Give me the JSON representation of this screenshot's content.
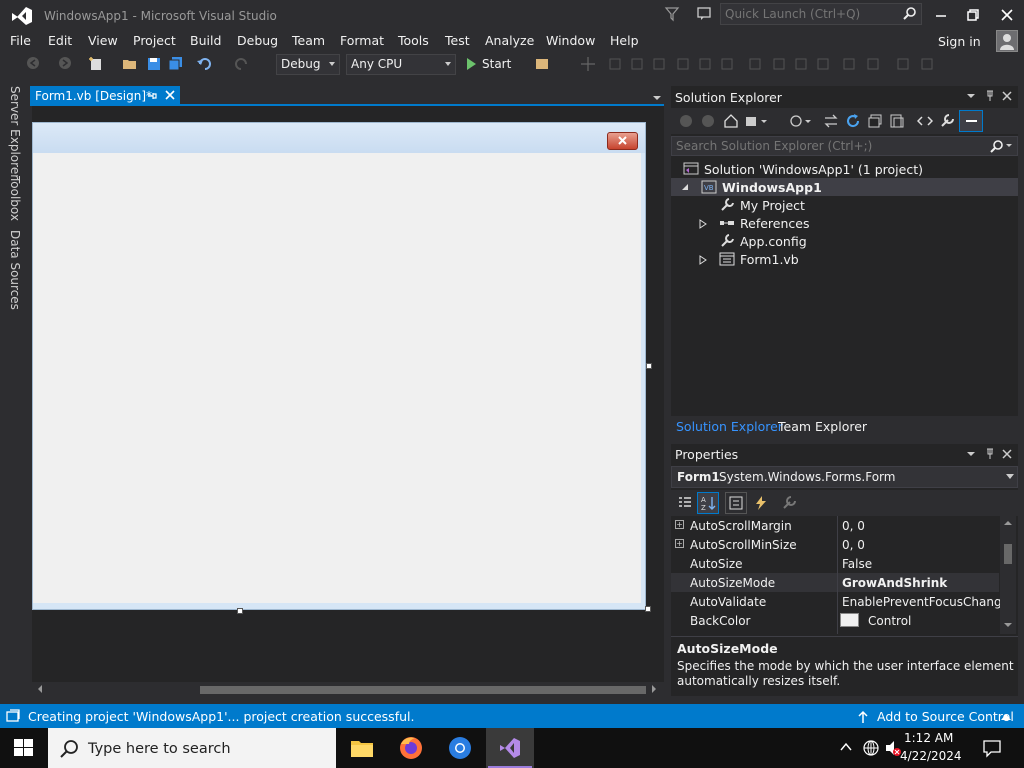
{
  "window": {
    "title": "WindowsApp1 - Microsoft Visual Studio"
  },
  "quick_launch": {
    "placeholder": "Quick Launch (Ctrl+Q)"
  },
  "menu": [
    "File",
    "Edit",
    "View",
    "Project",
    "Build",
    "Debug",
    "Team",
    "Format",
    "Tools",
    "Test",
    "Analyze",
    "Window",
    "Help"
  ],
  "account": {
    "signin": "Sign in"
  },
  "toolbar": {
    "config": "Debug",
    "platform": "Any CPU",
    "start": "Start"
  },
  "sidebar_tabs": [
    "Server Explorer",
    "Toolbox",
    "Data Sources"
  ],
  "document": {
    "tab": "Form1.vb [Design]*"
  },
  "solution_explorer": {
    "title": "Solution Explorer",
    "search_placeholder": "Search Solution Explorer (Ctrl+;)",
    "tree": [
      {
        "label": "Solution 'WindowsApp1' (1 project)",
        "icon": "solution-icon"
      },
      {
        "label": "WindowsApp1",
        "icon": "vb-project-icon",
        "expanded": true
      },
      {
        "label": "My Project",
        "icon": "wrench-icon"
      },
      {
        "label": "References",
        "icon": "references-icon"
      },
      {
        "label": "App.config",
        "icon": "config-file-icon"
      },
      {
        "label": "Form1.vb",
        "icon": "form-file-icon"
      }
    ],
    "tabs": [
      "Solution Explorer",
      "Team Explorer"
    ]
  },
  "properties": {
    "title": "Properties",
    "object_name": "Form1",
    "object_type": "System.Windows.Forms.Form",
    "rows": [
      {
        "name": "AutoScrollMargin",
        "value": "0, 0",
        "expandable": true
      },
      {
        "name": "AutoScrollMinSize",
        "value": "0, 0",
        "expandable": true
      },
      {
        "name": "AutoSize",
        "value": "False"
      },
      {
        "name": "AutoSizeMode",
        "value": "GrowAndShrink",
        "bold": true
      },
      {
        "name": "AutoValidate",
        "value": "EnablePreventFocusChange"
      },
      {
        "name": "BackColor",
        "value": "Control",
        "swatch": "#f0f0f0"
      }
    ],
    "desc_title": "AutoSizeMode",
    "desc_text_1": "Specifies the mode by which the user interface element",
    "desc_text_2": "automatically resizes itself."
  },
  "status": {
    "message": "Creating project 'WindowsApp1'... project creation successful.",
    "source_control": "Add to Source Control"
  },
  "taskbar": {
    "search_placeholder": "Type here to search",
    "time": "1:12 AM",
    "date": "4/22/2024"
  },
  "colors": {
    "accent": "#007acc",
    "background": "#2d2d30",
    "panel": "#252526"
  }
}
